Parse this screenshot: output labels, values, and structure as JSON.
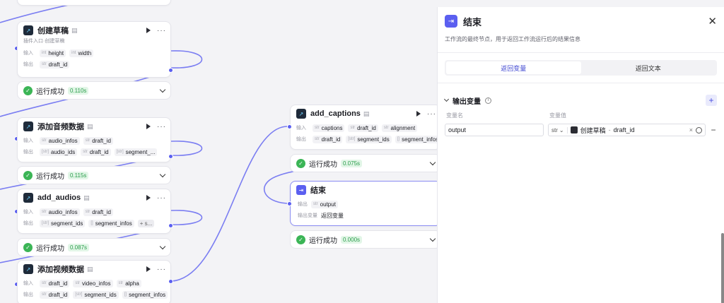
{
  "nodes": {
    "create_draft": {
      "title": "创建草稿",
      "subtitle": "插件入口·创建草稿",
      "inputs_label": "输入",
      "outputs_label": "输出",
      "inputs": [
        {
          "type": "int",
          "name": "height"
        },
        {
          "type": "int",
          "name": "width"
        }
      ],
      "outputs": [
        {
          "type": "str",
          "name": "draft_id"
        }
      ]
    },
    "add_audio_data": {
      "title": "添加音频数据",
      "inputs_label": "输入",
      "outputs_label": "输出",
      "inputs": [
        {
          "type": "str",
          "name": "audio_infos"
        },
        {
          "type": "str",
          "name": "draft_id"
        }
      ],
      "outputs": [
        {
          "type": "[str]",
          "name": "audio_ids"
        },
        {
          "type": "str",
          "name": "draft_id"
        },
        {
          "type": "[str]",
          "name": "segment_..."
        }
      ]
    },
    "add_audios": {
      "title": "add_audios",
      "inputs_label": "输入",
      "outputs_label": "输出",
      "inputs": [
        {
          "type": "str",
          "name": "audio_infos"
        },
        {
          "type": "str",
          "name": "draft_id"
        }
      ],
      "outputs": [
        {
          "type": "[str]",
          "name": "segment_ids"
        },
        {
          "type": "[]",
          "name": "segment_infos"
        },
        {
          "type": "",
          "name": "+ s..."
        }
      ]
    },
    "add_video_data": {
      "title": "添加视频数据",
      "inputs_label": "输入",
      "outputs_label": "输出",
      "inputs": [
        {
          "type": "str",
          "name": "draft_id"
        },
        {
          "type": "str",
          "name": "video_infos"
        },
        {
          "type": "str",
          "name": "alpha"
        }
      ],
      "outputs": [
        {
          "type": "str",
          "name": "draft_id"
        },
        {
          "type": "[str]",
          "name": "segment_ids"
        },
        {
          "type": "[]",
          "name": "segment_infos"
        }
      ]
    },
    "add_captions": {
      "title": "add_captions",
      "inputs_label": "输入",
      "outputs_label": "输出",
      "inputs": [
        {
          "type": "str",
          "name": "captions"
        },
        {
          "type": "str",
          "name": "draft_id"
        },
        {
          "type": "str",
          "name": "alignment"
        }
      ],
      "outputs": [
        {
          "type": "str",
          "name": "draft_id"
        },
        {
          "type": "[str]",
          "name": "segment_ids"
        },
        {
          "type": "[]",
          "name": "segment_infos"
        }
      ]
    },
    "end": {
      "title": "结束",
      "outputs_label": "输出",
      "output_name": "output",
      "output_type": "str",
      "mode_label": "输出变量",
      "mode_value": "返回变量"
    }
  },
  "statuses": {
    "s1": {
      "text": "运行成功",
      "time": "0.110s"
    },
    "s2": {
      "text": "运行成功",
      "time": "0.115s"
    },
    "s3": {
      "text": "运行成功",
      "time": "0.087s"
    },
    "s4": {
      "text": "运行成功",
      "time": "0.075s"
    },
    "s5": {
      "text": "运行成功",
      "time": "0.000s"
    }
  },
  "panel": {
    "title": "结束",
    "description": "工作流的最终节点，用于返回工作流运行后的结果信息",
    "tabs": [
      "返回变量",
      "返回文本"
    ],
    "active_tab": "返回变量",
    "section_title": "输出变量",
    "col_name": "变量名",
    "col_value": "变量值",
    "var_name": "output",
    "var_type": "str",
    "ref_node": "创建草稿",
    "ref_sep": "-",
    "ref_var": "draft_id"
  },
  "colors": {
    "accent": "#5b5ff0",
    "success": "#3bb556"
  },
  "icons": {
    "close": "close-icon",
    "add": "plus-icon",
    "remove": "minus-icon"
  }
}
